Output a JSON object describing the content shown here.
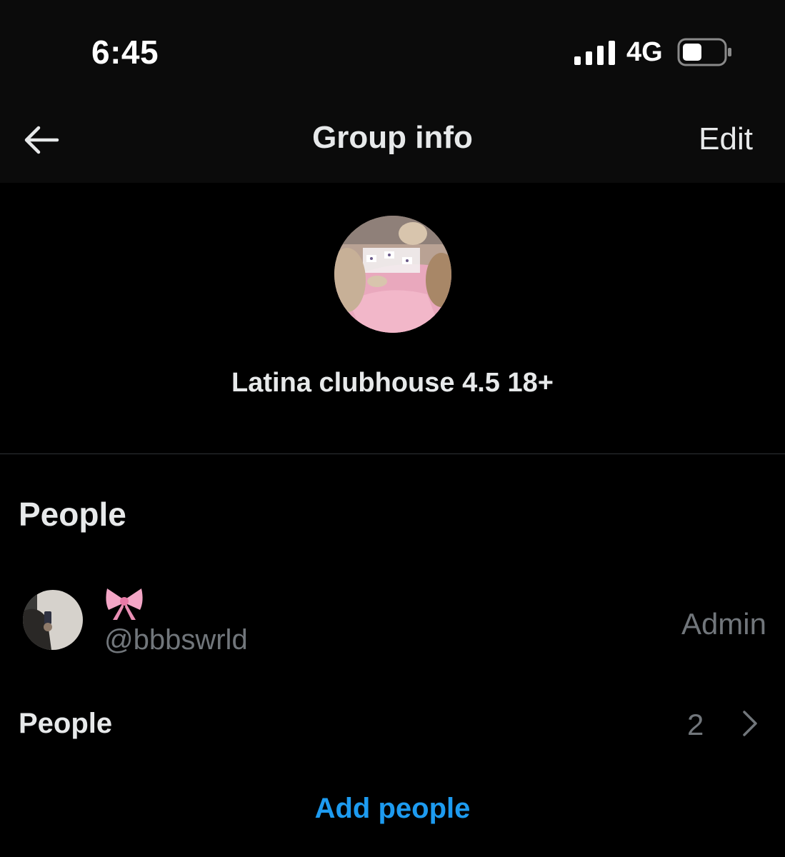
{
  "status_bar": {
    "time": "6:45",
    "network": "4G",
    "signal_icon": "signal-bars-icon",
    "battery_icon": "battery-icon"
  },
  "header": {
    "back_icon": "back-arrow-icon",
    "title": "Group info",
    "edit_label": "Edit"
  },
  "group": {
    "name": "Latina clubhouse 4.5 18+",
    "avatar": "cats-playing-cards-photo"
  },
  "people_section": {
    "heading": "People",
    "members": [
      {
        "display_name_icon": "pink-bow-emoji",
        "handle": "@bbbswrld",
        "role": "Admin"
      }
    ],
    "people_row": {
      "label": "People",
      "count": "2",
      "chevron_icon": "chevron-right-icon"
    },
    "add_people_label": "Add people"
  },
  "colors": {
    "background": "#000000",
    "header_bg": "#0b0b0b",
    "text": "#e7e9ea",
    "muted": "#71767b",
    "accent": "#1d9bf0",
    "divider": "#2f3336"
  }
}
